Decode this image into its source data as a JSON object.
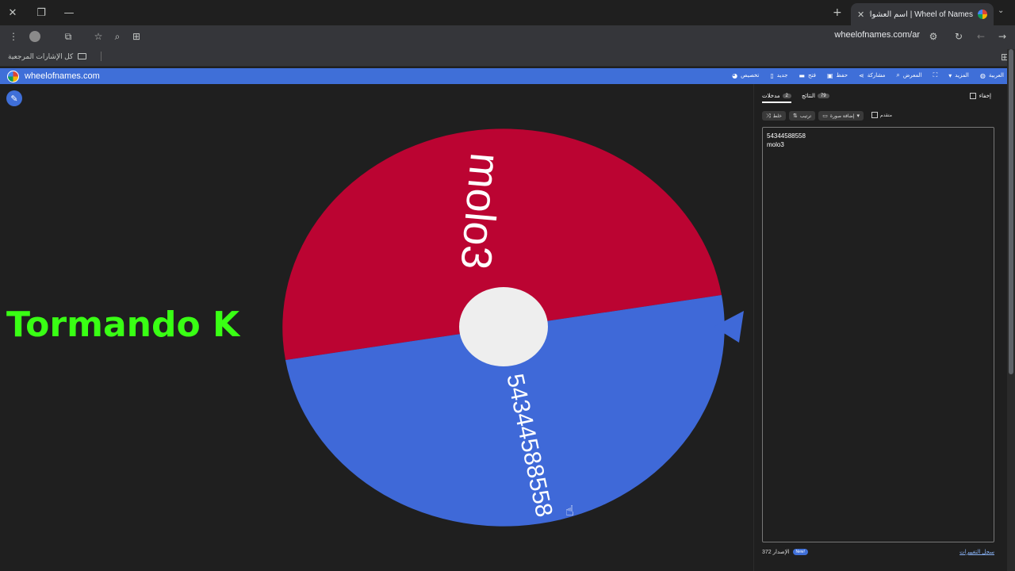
{
  "browser": {
    "tab_title": "Wheel of Names | اسم العشوائي",
    "url": "wheelofnames.com/ar",
    "bookmarks_label": "كل الإشارات المرجعية"
  },
  "site": {
    "title": "wheelofnames.com",
    "menu": [
      {
        "label": "العربية",
        "icon": "globe-icon"
      },
      {
        "label": "المزيد",
        "icon": "chevron-down-icon"
      },
      {
        "label": "",
        "icon": "fullscreen-icon"
      },
      {
        "label": "المعرض",
        "icon": "search-icon"
      },
      {
        "label": "مشاركة",
        "icon": "share-icon"
      },
      {
        "label": "حفظ",
        "icon": "save-icon"
      },
      {
        "label": "فتح",
        "icon": "folder-icon"
      },
      {
        "label": "جديد",
        "icon": "file-icon"
      },
      {
        "label": "تخصيص",
        "icon": "palette-icon"
      }
    ]
  },
  "sidebar": {
    "tab_entries": "مدخلات",
    "tab_entries_count": "2",
    "tab_results": "النتائج",
    "tab_results_count": "79",
    "hide_label": "إخفاء",
    "tools": {
      "shuffle": "خلط",
      "sort": "ترتيب",
      "add_image": "إضافة صورة",
      "advanced": "متقدم"
    },
    "entries": [
      "54344588558",
      "molo3"
    ],
    "version_label": "الإصدار 372",
    "new_badge": "New!",
    "changelog": "سجل التغييرات"
  },
  "overlay": {
    "text": "Tormando K"
  },
  "wheel": {
    "segments": [
      {
        "label": "molo3",
        "color": "#bb0432"
      },
      {
        "label": "54344588558",
        "color": "#3f69d8"
      }
    ],
    "hub_color": "#eeeeee",
    "pointer_color": "#3f69d8"
  }
}
